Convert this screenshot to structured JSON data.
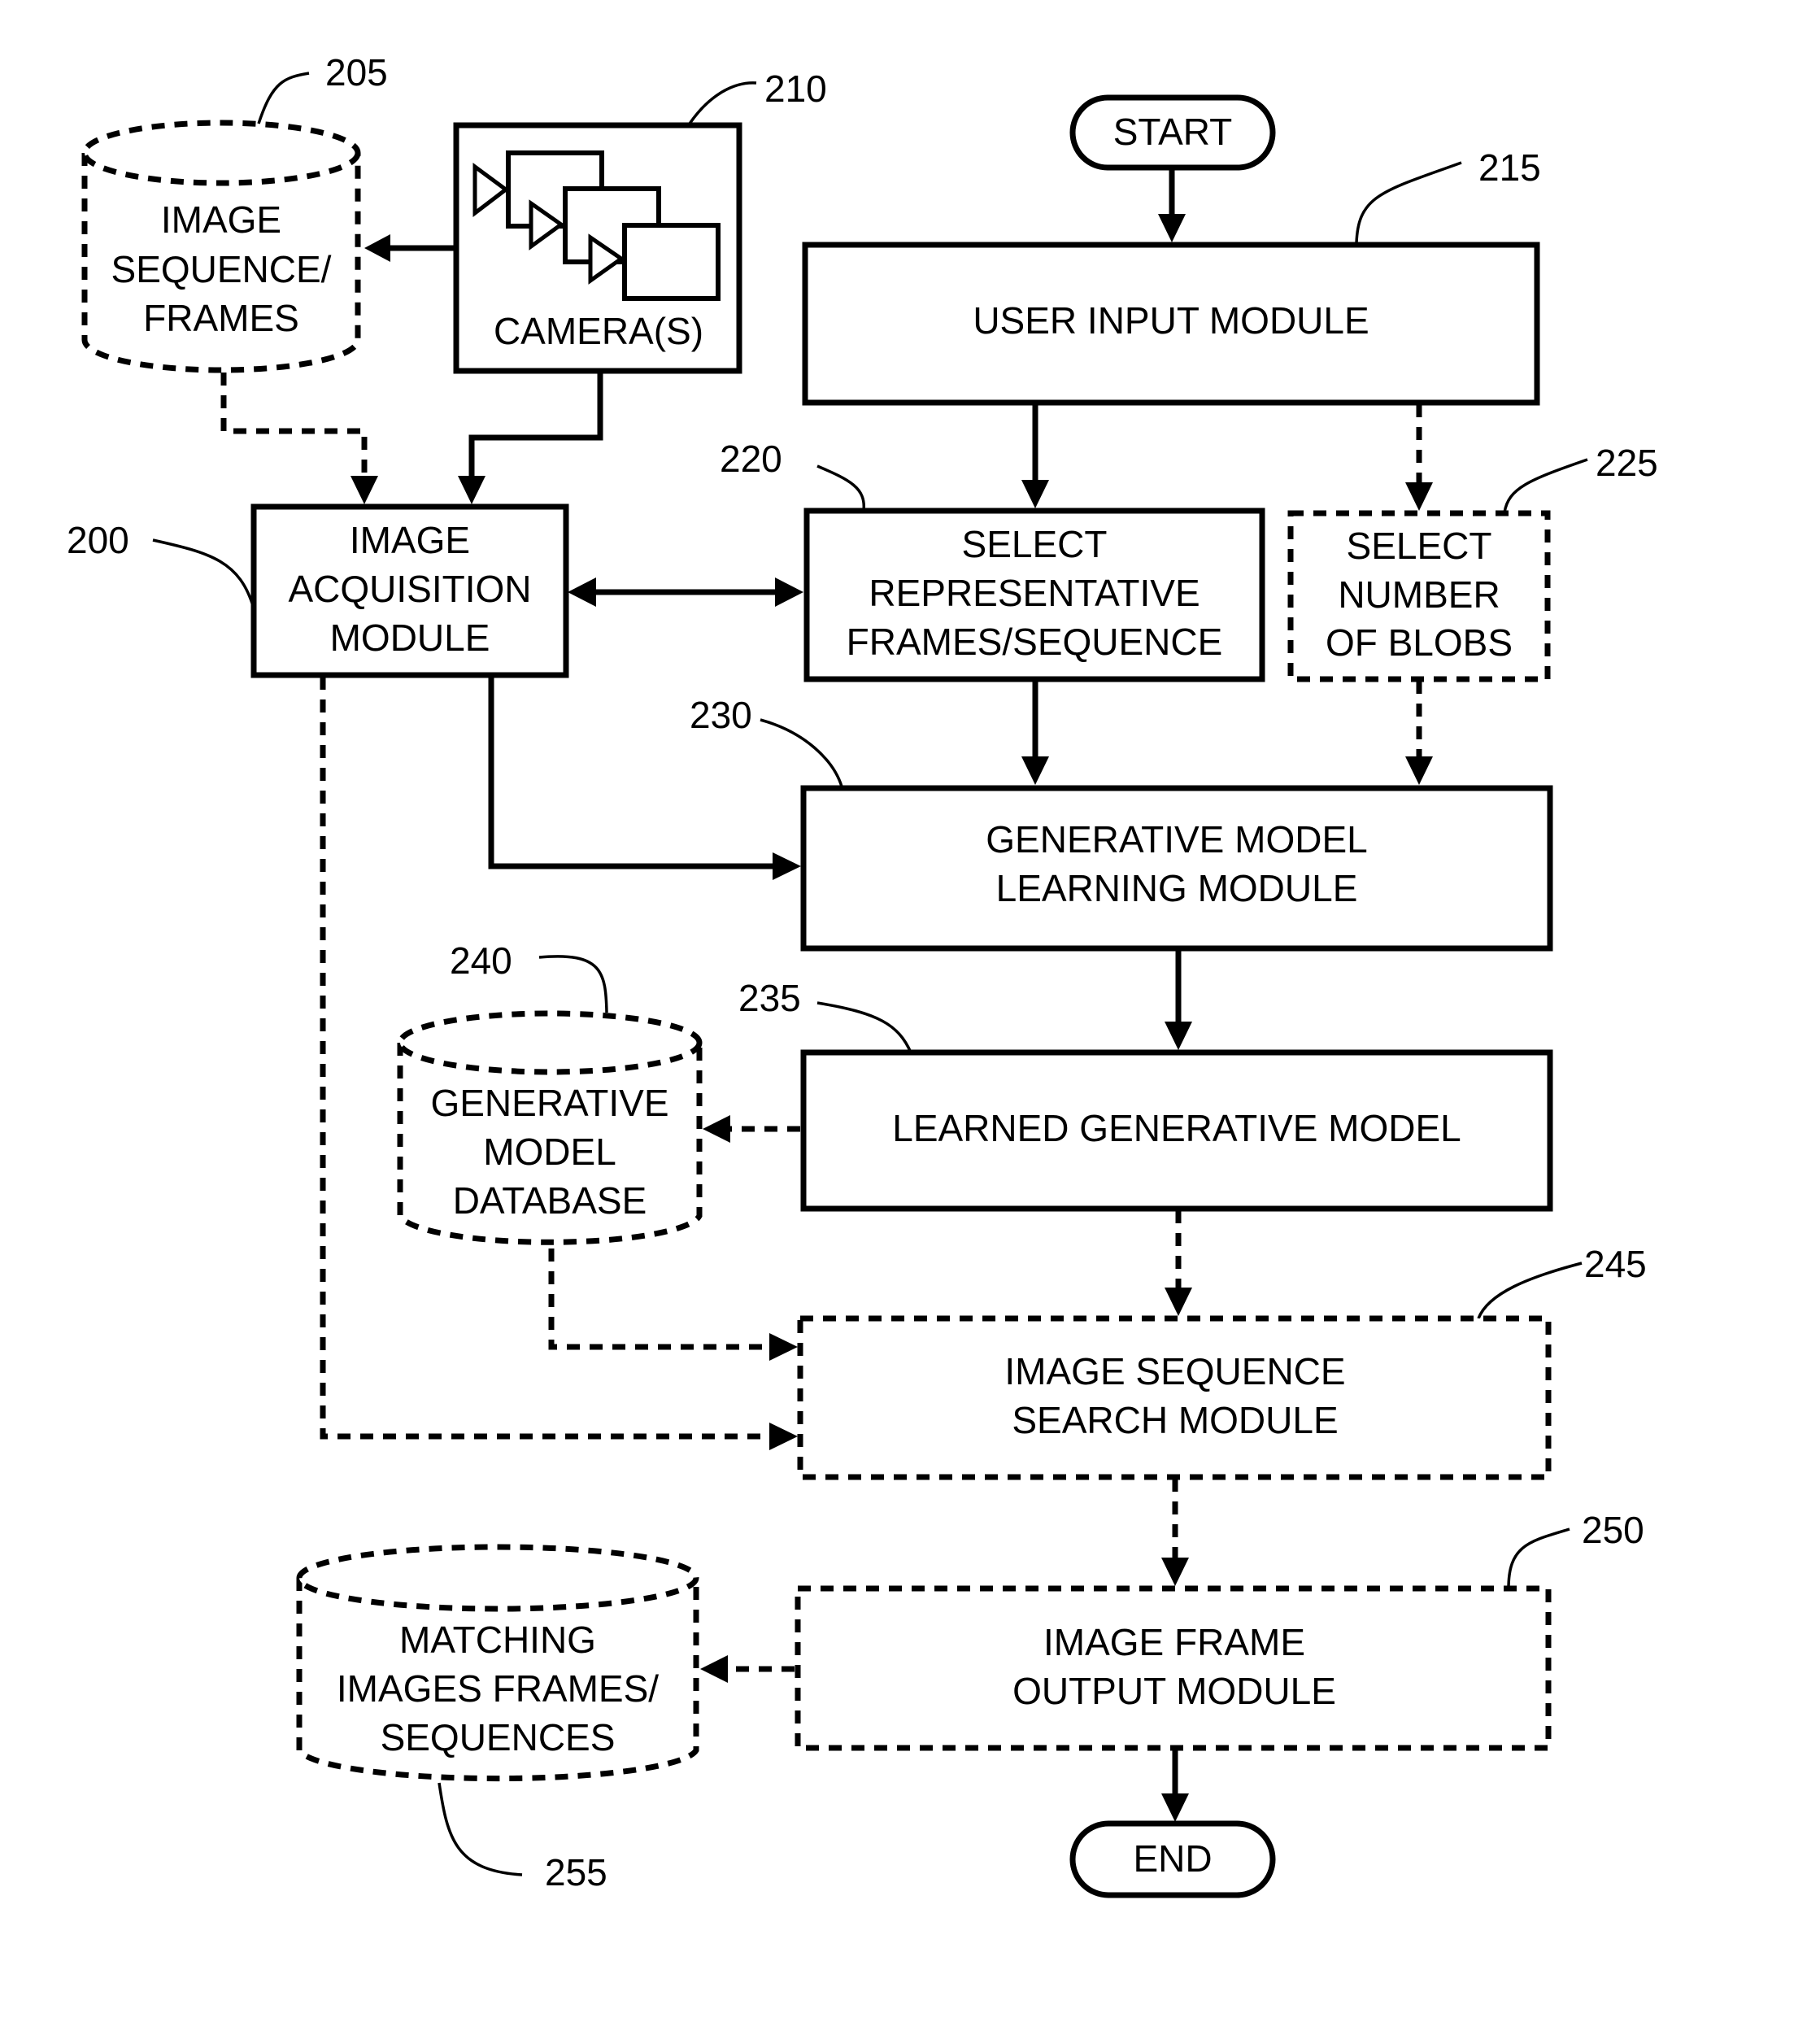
{
  "figure": {
    "type": "flowchart",
    "terminals": {
      "start": "START",
      "end": "END"
    },
    "nodes": {
      "image_sequence_frames": {
        "ref": "205",
        "shape": "database",
        "style": "dashed",
        "lines": [
          "IMAGE",
          "SEQUENCE/",
          "FRAMES"
        ]
      },
      "cameras": {
        "ref": "210",
        "shape": "box",
        "style": "solid",
        "lines": [
          "CAMERA(S)"
        ],
        "icon": "video-camera-stack-icon"
      },
      "user_input_module": {
        "ref": "215",
        "shape": "box",
        "style": "solid",
        "lines": [
          "USER INPUT MODULE"
        ]
      },
      "image_acquisition_module": {
        "ref": "200",
        "shape": "box",
        "style": "solid",
        "lines": [
          "IMAGE",
          "ACQUISITION",
          "MODULE"
        ]
      },
      "select_representative": {
        "ref": "220",
        "shape": "box",
        "style": "solid",
        "lines": [
          "SELECT",
          "REPRESENTATIVE",
          "FRAMES/SEQUENCE"
        ]
      },
      "select_number_of_blobs": {
        "ref": "225",
        "shape": "box",
        "style": "dashed",
        "lines": [
          "SELECT",
          "NUMBER",
          "OF BLOBS"
        ]
      },
      "generative_model_learning": {
        "ref": "230",
        "shape": "box",
        "style": "solid",
        "lines": [
          "GENERATIVE MODEL",
          "LEARNING MODULE"
        ]
      },
      "learned_generative_model": {
        "ref": "235",
        "shape": "box",
        "style": "solid",
        "lines": [
          "LEARNED GENERATIVE MODEL"
        ]
      },
      "generative_model_database": {
        "ref": "240",
        "shape": "database",
        "style": "dashed",
        "lines": [
          "GENERATIVE",
          "MODEL",
          "DATABASE"
        ]
      },
      "image_sequence_search": {
        "ref": "245",
        "shape": "box",
        "style": "dashed",
        "lines": [
          "IMAGE SEQUENCE",
          "SEARCH MODULE"
        ]
      },
      "image_frame_output": {
        "ref": "250",
        "shape": "box",
        "style": "dashed",
        "lines": [
          "IMAGE FRAME",
          "OUTPUT MODULE"
        ]
      },
      "matching_frames": {
        "ref": "255",
        "shape": "database",
        "style": "dashed",
        "lines": [
          "MATCHING",
          "IMAGES FRAMES/",
          "SEQUENCES"
        ]
      }
    },
    "edges": [
      {
        "from": "cameras",
        "to": "image_sequence_frames",
        "style": "solid"
      },
      {
        "from": "image_sequence_frames",
        "to": "image_acquisition_module",
        "style": "dashed"
      },
      {
        "from": "cameras",
        "to": "image_acquisition_module",
        "style": "solid"
      },
      {
        "from": "start",
        "to": "user_input_module",
        "style": "solid"
      },
      {
        "from": "user_input_module",
        "to": "select_representative",
        "style": "solid"
      },
      {
        "from": "user_input_module",
        "to": "select_number_of_blobs",
        "style": "dashed"
      },
      {
        "from": "image_acquisition_module",
        "to": "select_representative",
        "style": "solid",
        "bidirectional": true
      },
      {
        "from": "select_representative",
        "to": "generative_model_learning",
        "style": "solid"
      },
      {
        "from": "select_number_of_blobs",
        "to": "generative_model_learning",
        "style": "dashed"
      },
      {
        "from": "image_acquisition_module",
        "to": "generative_model_learning",
        "style": "solid"
      },
      {
        "from": "generative_model_learning",
        "to": "learned_generative_model",
        "style": "solid"
      },
      {
        "from": "learned_generative_model",
        "to": "generative_model_database",
        "style": "dashed"
      },
      {
        "from": "learned_generative_model",
        "to": "image_sequence_search",
        "style": "dashed"
      },
      {
        "from": "generative_model_database",
        "to": "image_sequence_search",
        "style": "dashed"
      },
      {
        "from": "image_acquisition_module",
        "to": "image_sequence_search",
        "style": "dashed"
      },
      {
        "from": "image_sequence_search",
        "to": "image_frame_output",
        "style": "dashed"
      },
      {
        "from": "image_frame_output",
        "to": "matching_frames",
        "style": "dashed"
      },
      {
        "from": "image_frame_output",
        "to": "end",
        "style": "solid"
      }
    ]
  }
}
